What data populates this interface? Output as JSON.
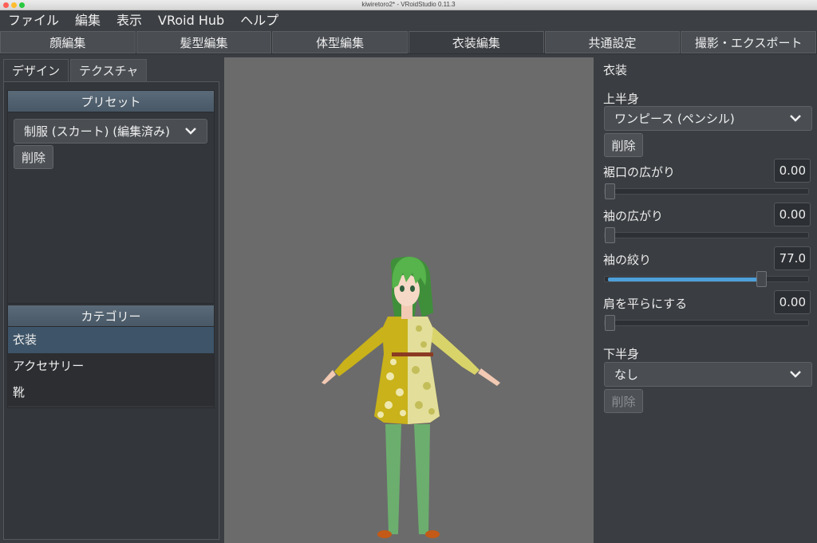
{
  "window": {
    "title": "kiwiretoro2* - VRoidStudio 0.11.3"
  },
  "menu": [
    "ファイル",
    "編集",
    "表示",
    "VRoid Hub",
    "ヘルプ"
  ],
  "main_tabs": [
    "顔編集",
    "髪型編集",
    "体型編集",
    "衣装編集",
    "共通設定",
    "撮影・エクスポート"
  ],
  "active_main_tab": "衣装編集",
  "left": {
    "subtabs": [
      "デザイン",
      "テクスチャ"
    ],
    "preset": {
      "header": "プリセット",
      "selected": "制服 (スカート) (編集済み)",
      "delete_label": "削除"
    },
    "category": {
      "header": "カテゴリー",
      "items": [
        "衣装",
        "アクセサリー",
        "靴"
      ],
      "selected": "衣装"
    }
  },
  "right": {
    "section_title": "衣装",
    "upper": {
      "label": "上半身",
      "selected": "ワンピース (ペンシル)",
      "delete_label": "削除",
      "sliders": [
        {
          "label": "裾口の広がり",
          "value": "0.00",
          "fraction": 0.0
        },
        {
          "label": "袖の広がり",
          "value": "0.00",
          "fraction": 0.0
        },
        {
          "label": "袖の絞り",
          "value": "77.0",
          "fraction": 0.77
        },
        {
          "label": "肩を平らにする",
          "value": "0.00",
          "fraction": 0.0
        }
      ]
    },
    "lower": {
      "label": "下半身",
      "selected": "なし",
      "delete_label": "削除"
    }
  },
  "colors": {
    "accent": "#4ea0d9",
    "section_header": "#526270",
    "selected_row": "#3e5468",
    "viewport_bg": "#6b6b6b"
  }
}
